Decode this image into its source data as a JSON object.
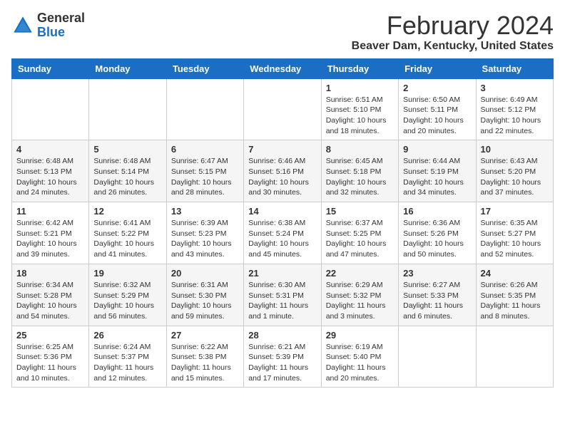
{
  "header": {
    "logo_general": "General",
    "logo_blue": "Blue",
    "month_title": "February 2024",
    "location": "Beaver Dam, Kentucky, United States"
  },
  "weekdays": [
    "Sunday",
    "Monday",
    "Tuesday",
    "Wednesday",
    "Thursday",
    "Friday",
    "Saturday"
  ],
  "weeks": [
    [
      {
        "day": "",
        "info": ""
      },
      {
        "day": "",
        "info": ""
      },
      {
        "day": "",
        "info": ""
      },
      {
        "day": "",
        "info": ""
      },
      {
        "day": "1",
        "info": "Sunrise: 6:51 AM\nSunset: 5:10 PM\nDaylight: 10 hours\nand 18 minutes."
      },
      {
        "day": "2",
        "info": "Sunrise: 6:50 AM\nSunset: 5:11 PM\nDaylight: 10 hours\nand 20 minutes."
      },
      {
        "day": "3",
        "info": "Sunrise: 6:49 AM\nSunset: 5:12 PM\nDaylight: 10 hours\nand 22 minutes."
      }
    ],
    [
      {
        "day": "4",
        "info": "Sunrise: 6:48 AM\nSunset: 5:13 PM\nDaylight: 10 hours\nand 24 minutes."
      },
      {
        "day": "5",
        "info": "Sunrise: 6:48 AM\nSunset: 5:14 PM\nDaylight: 10 hours\nand 26 minutes."
      },
      {
        "day": "6",
        "info": "Sunrise: 6:47 AM\nSunset: 5:15 PM\nDaylight: 10 hours\nand 28 minutes."
      },
      {
        "day": "7",
        "info": "Sunrise: 6:46 AM\nSunset: 5:16 PM\nDaylight: 10 hours\nand 30 minutes."
      },
      {
        "day": "8",
        "info": "Sunrise: 6:45 AM\nSunset: 5:18 PM\nDaylight: 10 hours\nand 32 minutes."
      },
      {
        "day": "9",
        "info": "Sunrise: 6:44 AM\nSunset: 5:19 PM\nDaylight: 10 hours\nand 34 minutes."
      },
      {
        "day": "10",
        "info": "Sunrise: 6:43 AM\nSunset: 5:20 PM\nDaylight: 10 hours\nand 37 minutes."
      }
    ],
    [
      {
        "day": "11",
        "info": "Sunrise: 6:42 AM\nSunset: 5:21 PM\nDaylight: 10 hours\nand 39 minutes."
      },
      {
        "day": "12",
        "info": "Sunrise: 6:41 AM\nSunset: 5:22 PM\nDaylight: 10 hours\nand 41 minutes."
      },
      {
        "day": "13",
        "info": "Sunrise: 6:39 AM\nSunset: 5:23 PM\nDaylight: 10 hours\nand 43 minutes."
      },
      {
        "day": "14",
        "info": "Sunrise: 6:38 AM\nSunset: 5:24 PM\nDaylight: 10 hours\nand 45 minutes."
      },
      {
        "day": "15",
        "info": "Sunrise: 6:37 AM\nSunset: 5:25 PM\nDaylight: 10 hours\nand 47 minutes."
      },
      {
        "day": "16",
        "info": "Sunrise: 6:36 AM\nSunset: 5:26 PM\nDaylight: 10 hours\nand 50 minutes."
      },
      {
        "day": "17",
        "info": "Sunrise: 6:35 AM\nSunset: 5:27 PM\nDaylight: 10 hours\nand 52 minutes."
      }
    ],
    [
      {
        "day": "18",
        "info": "Sunrise: 6:34 AM\nSunset: 5:28 PM\nDaylight: 10 hours\nand 54 minutes."
      },
      {
        "day": "19",
        "info": "Sunrise: 6:32 AM\nSunset: 5:29 PM\nDaylight: 10 hours\nand 56 minutes."
      },
      {
        "day": "20",
        "info": "Sunrise: 6:31 AM\nSunset: 5:30 PM\nDaylight: 10 hours\nand 59 minutes."
      },
      {
        "day": "21",
        "info": "Sunrise: 6:30 AM\nSunset: 5:31 PM\nDaylight: 11 hours\nand 1 minute."
      },
      {
        "day": "22",
        "info": "Sunrise: 6:29 AM\nSunset: 5:32 PM\nDaylight: 11 hours\nand 3 minutes."
      },
      {
        "day": "23",
        "info": "Sunrise: 6:27 AM\nSunset: 5:33 PM\nDaylight: 11 hours\nand 6 minutes."
      },
      {
        "day": "24",
        "info": "Sunrise: 6:26 AM\nSunset: 5:35 PM\nDaylight: 11 hours\nand 8 minutes."
      }
    ],
    [
      {
        "day": "25",
        "info": "Sunrise: 6:25 AM\nSunset: 5:36 PM\nDaylight: 11 hours\nand 10 minutes."
      },
      {
        "day": "26",
        "info": "Sunrise: 6:24 AM\nSunset: 5:37 PM\nDaylight: 11 hours\nand 12 minutes."
      },
      {
        "day": "27",
        "info": "Sunrise: 6:22 AM\nSunset: 5:38 PM\nDaylight: 11 hours\nand 15 minutes."
      },
      {
        "day": "28",
        "info": "Sunrise: 6:21 AM\nSunset: 5:39 PM\nDaylight: 11 hours\nand 17 minutes."
      },
      {
        "day": "29",
        "info": "Sunrise: 6:19 AM\nSunset: 5:40 PM\nDaylight: 11 hours\nand 20 minutes."
      },
      {
        "day": "",
        "info": ""
      },
      {
        "day": "",
        "info": ""
      }
    ]
  ]
}
